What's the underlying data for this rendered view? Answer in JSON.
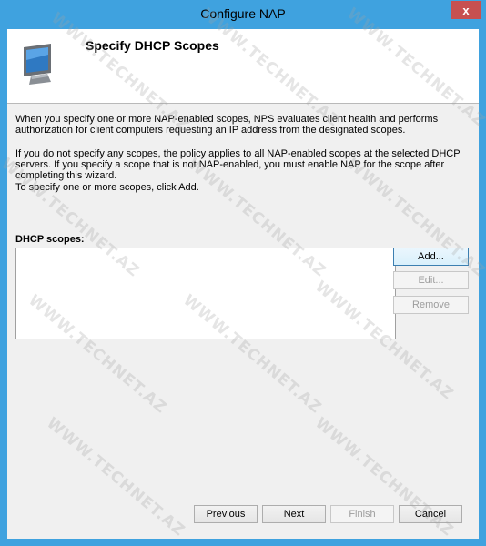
{
  "window": {
    "title": "Configure NAP",
    "close_glyph": "x"
  },
  "header": {
    "title": "Specify DHCP Scopes",
    "icon": "computer-monitor-icon"
  },
  "body": {
    "para1": "When you specify one or more NAP-enabled scopes, NPS evaluates client health and performs authorization for client computers requesting an IP address from the designated scopes.",
    "para2": "If you do not specify any scopes, the policy applies to all NAP-enabled scopes at the selected DHCP servers. If you specify a scope that is not NAP-enabled, you must enable NAP for the scope after completing this wizard.",
    "para3": "To specify one or more scopes, click Add."
  },
  "scopes": {
    "label": "DHCP scopes:",
    "items": []
  },
  "side_buttons": {
    "add": "Add...",
    "edit": "Edit...",
    "remove": "Remove"
  },
  "footer_buttons": {
    "previous": "Previous",
    "next": "Next",
    "finish": "Finish",
    "cancel": "Cancel"
  },
  "watermark": "WWW.TECHNET.AZ",
  "colors": {
    "title_bar": "#3fa2df",
    "close_button": "#c75050",
    "dialog_bg": "#f0f0f0"
  }
}
